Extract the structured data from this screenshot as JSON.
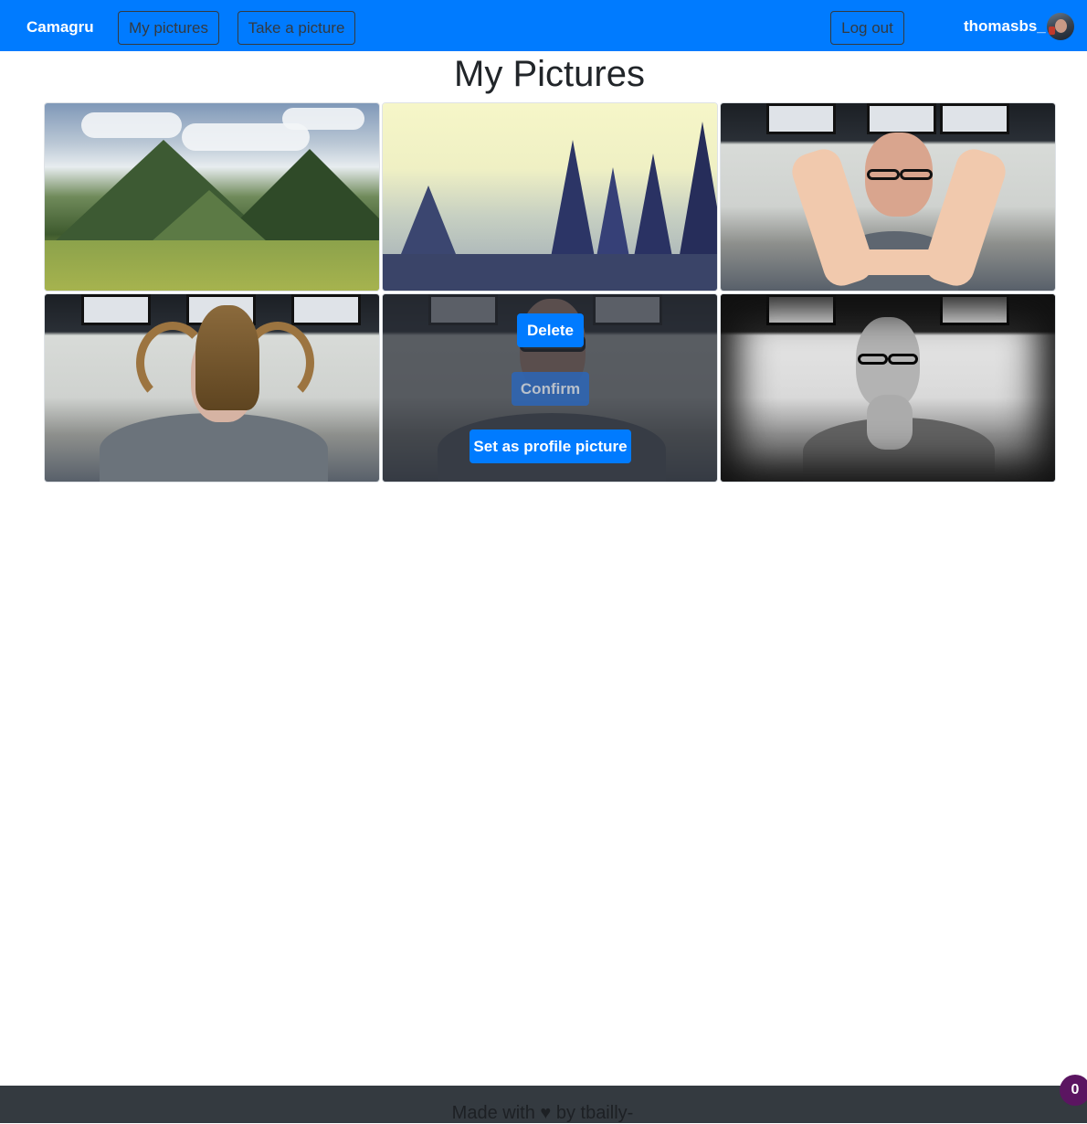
{
  "app": {
    "brand": "Camagru",
    "accent_color": "#007bff"
  },
  "navbar": {
    "my_pictures_label": "My pictures",
    "take_picture_label": "Take a picture",
    "logout_label": "Log out",
    "username": "thomasbs_",
    "avatar_icon": "user-avatar-icon"
  },
  "page": {
    "title": "My Pictures"
  },
  "gallery": {
    "pictures": [
      {
        "description": "mountain-valley-photo"
      },
      {
        "description": "foggy-forest-photo"
      },
      {
        "description": "webcam-hands-frame-photo"
      },
      {
        "description": "webcam-horned-helmet-photo"
      },
      {
        "description": "webcam-sunglasses-photo",
        "selected": true
      },
      {
        "description": "webcam-grayscale-photo"
      }
    ],
    "overlay": {
      "delete_label": "Delete",
      "confirm_label": "Confirm",
      "set_profile_label": "Set as profile picture"
    }
  },
  "footer": {
    "text_before": "Made with",
    "heart_glyph": "♥",
    "text_after": "by tbailly-",
    "heart_icon": "heart-icon"
  },
  "notification_badge": {
    "count": "0",
    "color": "#5b1561"
  }
}
